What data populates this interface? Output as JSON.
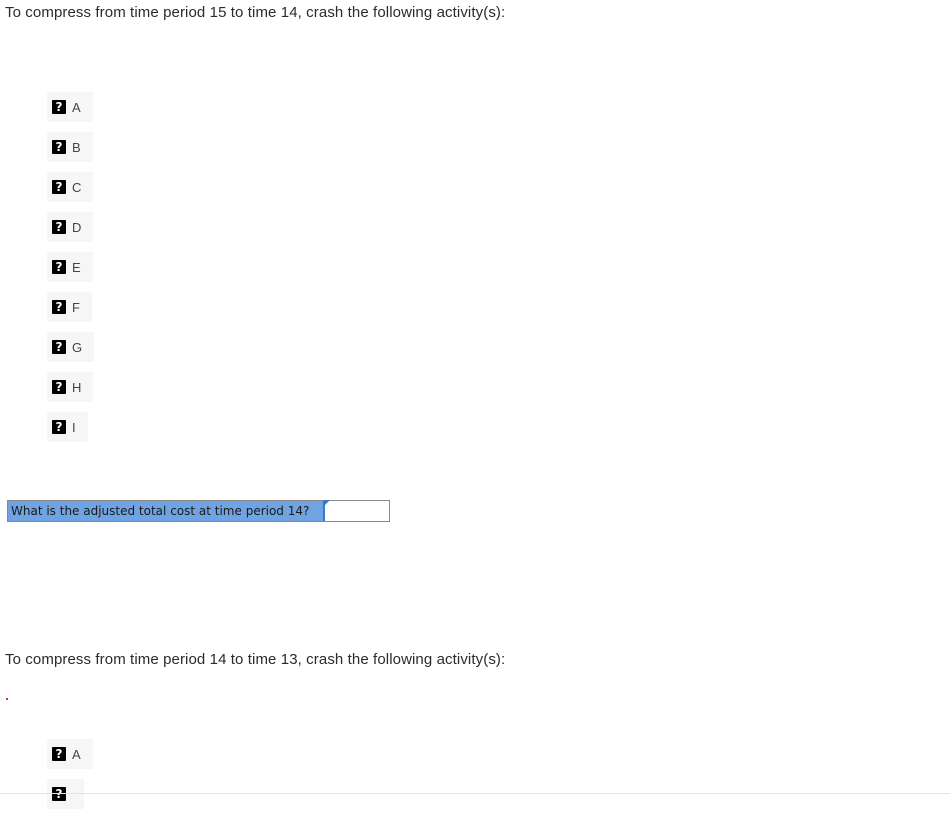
{
  "section1": {
    "prompt": "To compress from time period 15 to time 14, crash the following activity(s):",
    "options": [
      {
        "label": "A",
        "icon": "question-icon",
        "icon_glyph": "?"
      },
      {
        "label": "B",
        "icon": "question-icon",
        "icon_glyph": "?"
      },
      {
        "label": "C",
        "icon": "question-icon",
        "icon_glyph": "?"
      },
      {
        "label": "D",
        "icon": "question-icon",
        "icon_glyph": "?"
      },
      {
        "label": "E",
        "icon": "question-icon",
        "icon_glyph": "?"
      },
      {
        "label": "F",
        "icon": "question-icon",
        "icon_glyph": "?"
      },
      {
        "label": "G",
        "icon": "question-icon",
        "icon_glyph": "?"
      },
      {
        "label": "H",
        "icon": "question-icon",
        "icon_glyph": "?"
      },
      {
        "label": "I",
        "icon": "question-icon",
        "icon_glyph": "?"
      }
    ]
  },
  "cost_question": {
    "label": "What is the adjusted total cost at time period 14?",
    "value": "",
    "label_bg": "#6fa3e2",
    "accent": "#3a78c9"
  },
  "section2": {
    "prompt": "To compress from time period 14 to time 13, crash the following activity(s):",
    "options": [
      {
        "label": "A",
        "icon": "question-icon",
        "icon_glyph": "?"
      },
      {
        "label": "",
        "icon": "question-icon",
        "icon_glyph": "?"
      }
    ]
  }
}
